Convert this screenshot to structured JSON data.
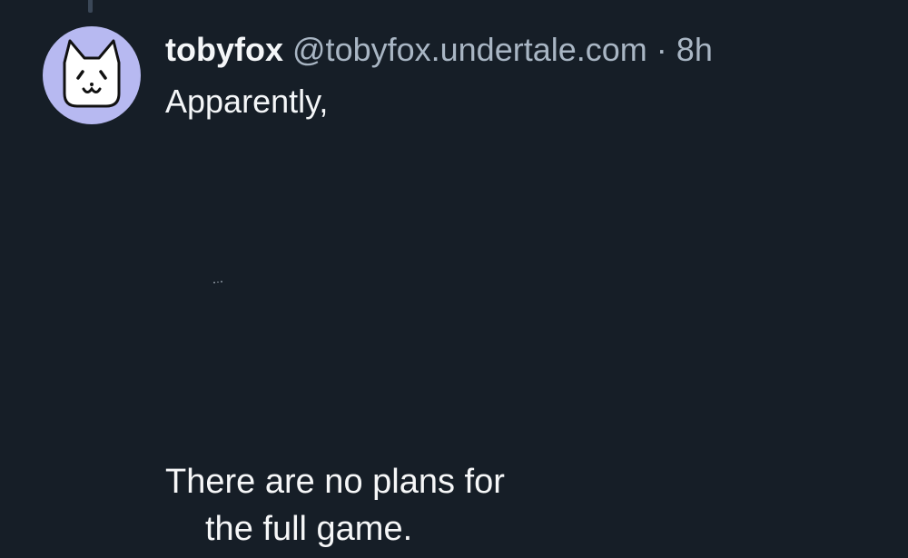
{
  "post": {
    "display_name": "tobyfox",
    "handle": "@tobyfox.undertale.com",
    "separator": "·",
    "timestamp": "8h",
    "text": "Apparently,",
    "avatar_icon": "dog-face-icon"
  },
  "media": {
    "caption_line_1": "There are no plans for",
    "caption_line_2": "the full game."
  },
  "colors": {
    "background": "#161e27",
    "avatar_bg": "#b7b9f1",
    "secondary_text": "#a9b6c4",
    "primary_text": "#f4f6f8"
  }
}
